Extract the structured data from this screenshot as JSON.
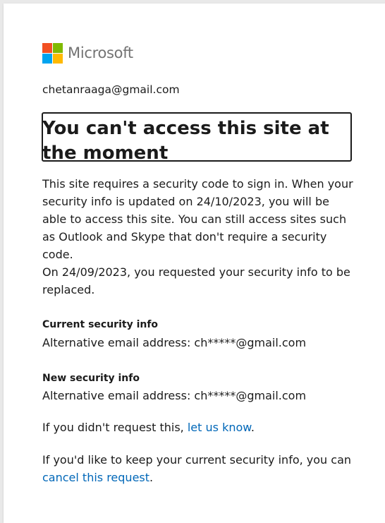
{
  "brand": {
    "name": "Microsoft",
    "logo_colors": [
      "#f25022",
      "#7fba00",
      "#00a4ef",
      "#ffb900"
    ]
  },
  "identity": "chetanraaga@gmail.com",
  "title": "You can't access this site at the moment",
  "message": {
    "line1": "This site requires a security code to sign in. When your security info is updated on 24/10/2023, you will be able to access this site. You can still access sites such as Outlook and Skype that don't require a security code.",
    "line2": "On 24/09/2023, you requested your security info to be replaced."
  },
  "current_info": {
    "label": "Current security info",
    "value": "Alternative email address: ch*****@gmail.com"
  },
  "new_info": {
    "label": "New security info",
    "value": "Alternative email address: ch*****@gmail.com"
  },
  "report": {
    "prefix": "If you didn't request this, ",
    "link": "let us know",
    "suffix": "."
  },
  "cancel": {
    "prefix": "If you'd like to keep your current security info, you can ",
    "link": "cancel this request",
    "suffix": "."
  }
}
